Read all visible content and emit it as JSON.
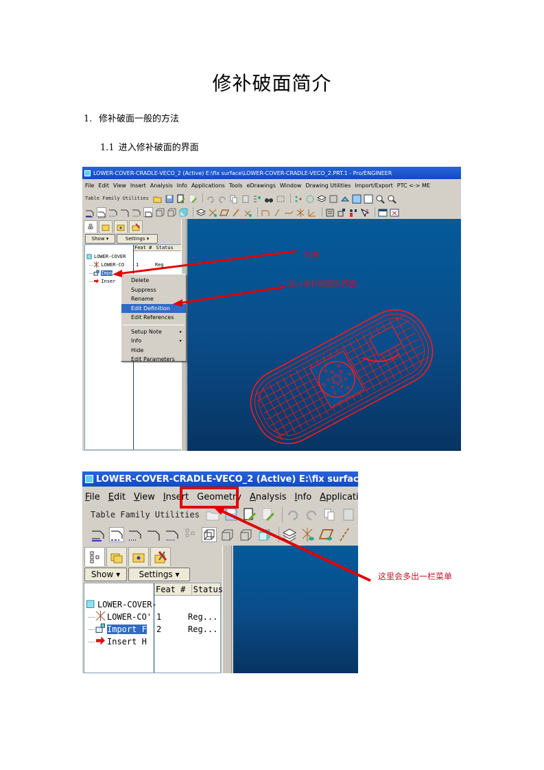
{
  "document": {
    "title": "修补破面简介",
    "section_1": {
      "number": "1.",
      "text": "修补破面一般的方法"
    },
    "section_1_1": {
      "number": "1.1",
      "text": "进入修补破面的界面"
    }
  },
  "screenshot_1": {
    "window_title": "LOWER-COVER-CRADLE-VECO_2 (Active) E:\\fix surface\\LOWER-COVER-CRADLE-VECO_2.PRT.1 - Pro/ENGINEER",
    "menu": [
      "File",
      "Edit",
      "View",
      "Insert",
      "Analysis",
      "Info",
      "Applications",
      "Tools",
      "eDrawings",
      "Window",
      "Drawing Utilities",
      "Import/Export",
      "PTC <-> ME"
    ],
    "toolbar_label": "Table Family Utilities",
    "panel_tabs": [
      "model-tree",
      "folder",
      "favorites",
      "tools"
    ],
    "panel_buttons": {
      "show": "Show ▾",
      "settings": "Settings ▾"
    },
    "tree_columns": {
      "feat": "Feat #",
      "status": "Status"
    },
    "tree_items": [
      {
        "label": "LOWER-COVER",
        "icon": "part-icon",
        "feat": "",
        "status": ""
      },
      {
        "label": "LOWER-CO",
        "icon": "csys-icon",
        "feat": "1",
        "status": "Reg"
      },
      {
        "label": "Impo",
        "icon": "import-feature-icon",
        "feat": "",
        "status": "",
        "selected": true
      },
      {
        "label": "Inser",
        "icon": "insert-here-arrow-icon",
        "feat": "",
        "status": ""
      }
    ],
    "context_menu": [
      {
        "label": "Delete"
      },
      {
        "label": "Suppress"
      },
      {
        "label": "Rename"
      },
      {
        "label": "Edit Definition",
        "highlighted": true
      },
      {
        "label": "Edit References"
      },
      {
        "separator": true
      },
      {
        "label": "Setup Note",
        "submenu": true
      },
      {
        "label": "Info",
        "submenu": true
      },
      {
        "label": "Hide"
      },
      {
        "label": "Edit Parameters"
      }
    ],
    "annotations": {
      "right_click": "右键",
      "enter_repair": "进入修补破面的界面"
    },
    "colors": {
      "viewport": "#0a4d8a",
      "wireframe": "#ff1a1a",
      "arrow": "#e00000"
    }
  },
  "screenshot_2": {
    "window_title": "LOWER-COVER-CRADLE-VECO_2 (Active) E:\\fix surface\\LOWER-",
    "menu": [
      {
        "label": "File",
        "u": "F",
        "rest": "ile"
      },
      {
        "label": "Edit",
        "u": "E",
        "rest": "dit"
      },
      {
        "label": "View",
        "u": "V",
        "rest": "iew"
      },
      {
        "label": "Insert",
        "u": "I",
        "rest": "nsert"
      },
      {
        "label": "Geometry",
        "u": "",
        "rest": "Geometry"
      },
      {
        "label": "Analysis",
        "u": "A",
        "rest": "nalysis"
      },
      {
        "label": "Info",
        "u": "I",
        "rest": "nfo"
      },
      {
        "label": "Applications",
        "u": "A",
        "rest": "pplications"
      }
    ],
    "toolbar_label": "Table Family Utilities",
    "panel_buttons": {
      "show": "Show ▾",
      "settings": "Settings ▾"
    },
    "tree_columns": {
      "feat": "Feat #",
      "status": "Status"
    },
    "tree_items": [
      {
        "label": "LOWER-COVER-",
        "icon": "part-icon",
        "feat": "",
        "status": ""
      },
      {
        "label": "LOWER-CO'",
        "icon": "csys-icon",
        "feat": "1",
        "status": "Reg..."
      },
      {
        "label": "Import F",
        "icon": "import-feature-icon",
        "feat": "2",
        "status": "Reg...",
        "selected": true
      },
      {
        "label": "Insert H",
        "icon": "insert-here-arrow-icon",
        "feat": "",
        "status": ""
      }
    ],
    "annotation": "这里会多出一栏菜单",
    "highlighted_menu": "Geometry"
  }
}
